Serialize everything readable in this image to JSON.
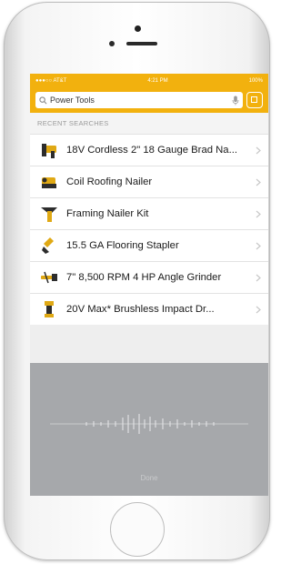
{
  "status_bar": {
    "carrier": "●●●○○ AT&T",
    "time": "4:21 PM",
    "battery": "100%"
  },
  "search": {
    "query": "Power Tools"
  },
  "recent": {
    "header": "RECENT SEARCHES",
    "items": [
      {
        "label": "18V Cordless 2\" 18 Gauge Brad Na..."
      },
      {
        "label": "Coil Roofing Nailer"
      },
      {
        "label": "Framing Nailer Kit"
      },
      {
        "label": "15.5 GA Flooring Stapler"
      },
      {
        "label": "7\" 8,500 RPM 4 HP Angle Grinder"
      },
      {
        "label": "20V Max* Brushless Impact Dr..."
      }
    ]
  },
  "voice": {
    "done_label": "Done"
  },
  "colors": {
    "accent": "#f2b10e",
    "voice_panel": "#a6a8ab"
  },
  "icons": [
    "magnifier-icon",
    "microphone-icon",
    "scan-icon",
    "chevron-right-icon"
  ]
}
